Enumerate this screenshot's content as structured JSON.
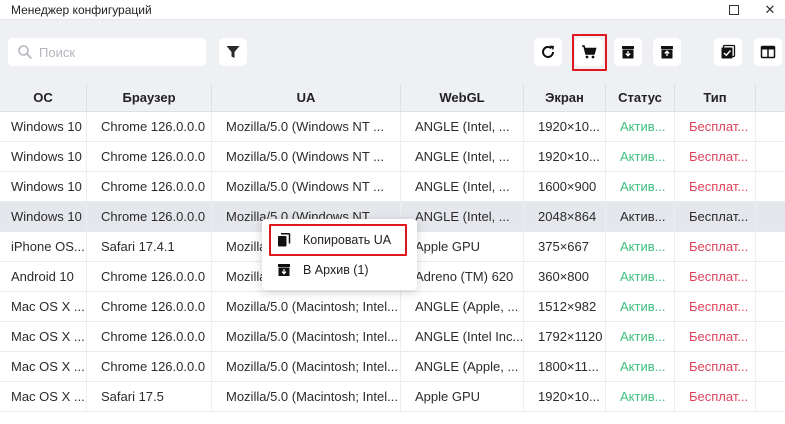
{
  "window": {
    "title": "Менеджер конфигураций",
    "maximize_icon": "maximize-icon",
    "close_glyph": "✕"
  },
  "toolbar": {
    "search_placeholder": "Поиск",
    "buttons": [
      "filter-icon",
      "refresh-icon",
      "cart-icon",
      "archive-down-icon",
      "archive-up-icon",
      "checkbox-icon",
      "columns-icon"
    ],
    "highlighted_button": "cart-icon",
    "highlight_color": "#e0161f"
  },
  "table": {
    "columns": [
      "ОС",
      "Браузер",
      "UA",
      "WebGL",
      "Экран",
      "Статус",
      "Тип"
    ],
    "rows": [
      {
        "os": "Windows 10",
        "browser": "Chrome 126.0.0.0",
        "ua": "Mozilla/5.0 (Windows NT ...",
        "webgl": "ANGLE (Intel, ...",
        "screen": "1920×10...",
        "status": "Актив...",
        "type": "Бесплат..."
      },
      {
        "os": "Windows 10",
        "browser": "Chrome 126.0.0.0",
        "ua": "Mozilla/5.0 (Windows NT ...",
        "webgl": "ANGLE (Intel, ...",
        "screen": "1920×10...",
        "status": "Актив...",
        "type": "Бесплат..."
      },
      {
        "os": "Windows 10",
        "browser": "Chrome 126.0.0.0",
        "ua": "Mozilla/5.0 (Windows NT ...",
        "webgl": "ANGLE (Intel, ...",
        "screen": "1600×900",
        "status": "Актив...",
        "type": "Бесплат..."
      },
      {
        "os": "Windows 10",
        "browser": "Chrome 126.0.0.0",
        "ua": "Mozilla/5.0 (Windows NT ...",
        "webgl": "ANGLE (Intel, ...",
        "screen": "2048×864",
        "status": "Актив...",
        "type": "Бесплат..."
      },
      {
        "os": "iPhone OS...",
        "browser": "Safari 17.4.1",
        "ua": "Mozilla/5.0 (iPhone; CPU i...",
        "webgl": "Apple GPU",
        "screen": "375×667",
        "status": "Актив...",
        "type": "Бесплат..."
      },
      {
        "os": "Android 10",
        "browser": "Chrome 126.0.0.0",
        "ua": "Mozilla/5.0 (Linux; Androi...",
        "webgl": "Adreno (TM) 620",
        "screen": "360×800",
        "status": "Актив...",
        "type": "Бесплат..."
      },
      {
        "os": "Mac OS X ...",
        "browser": "Chrome 126.0.0.0",
        "ua": "Mozilla/5.0 (Macintosh; Intel...",
        "webgl": "ANGLE (Apple, ...",
        "screen": "1512×982",
        "status": "Актив...",
        "type": "Бесплат..."
      },
      {
        "os": "Mac OS X ...",
        "browser": "Chrome 126.0.0.0",
        "ua": "Mozilla/5.0 (Macintosh; Intel...",
        "webgl": "ANGLE (Intel Inc...",
        "screen": "1792×1120",
        "status": "Актив...",
        "type": "Бесплат..."
      },
      {
        "os": "Mac OS X ...",
        "browser": "Chrome 126.0.0.0",
        "ua": "Mozilla/5.0 (Macintosh; Intel...",
        "webgl": "ANGLE (Apple, ...",
        "screen": "1800×11...",
        "status": "Актив...",
        "type": "Бесплат..."
      },
      {
        "os": "Mac OS X ...",
        "browser": "Safari 17.5",
        "ua": "Mozilla/5.0 (Macintosh; Intel...",
        "webgl": "Apple GPU",
        "screen": "1920×10...",
        "status": "Актив...",
        "type": "Бесплат..."
      }
    ],
    "selected_row": 3,
    "status_color": "#3ec07c",
    "type_color": "#e0425b"
  },
  "context_menu": {
    "items": [
      {
        "label": "Копировать UA",
        "icon": "copy-icon",
        "highlighted": true
      },
      {
        "label": "В Архив (1)",
        "icon": "archive-icon",
        "highlighted": false
      }
    ]
  }
}
